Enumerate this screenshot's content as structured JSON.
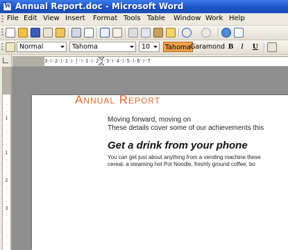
{
  "window": {
    "title": "Annual Report.doc - Microsoft Word"
  },
  "menu": {
    "items": [
      {
        "label": "File"
      },
      {
        "label": "Edit"
      },
      {
        "label": "View"
      },
      {
        "label": "Insert"
      },
      {
        "label": "Format"
      },
      {
        "label": "Tools"
      },
      {
        "label": "Table"
      },
      {
        "label": "Window"
      },
      {
        "label": "Work"
      },
      {
        "label": "Help"
      }
    ]
  },
  "toolbar": {
    "icons": [
      "new-document",
      "open",
      "save",
      "permission",
      "email",
      "print",
      "print-preview",
      "spelling",
      "research",
      "cut",
      "copy",
      "paste",
      "format-painter",
      "undo",
      "redo",
      "hyperlink",
      "tables-borders"
    ]
  },
  "formatting": {
    "style": "Normal",
    "font": "Tahoma",
    "size": "10",
    "font_preview_1": "Tahoma",
    "font_preview_2": "Garamond",
    "bold": "B",
    "italic": "I",
    "underline": "U"
  },
  "colors": {
    "title_bar": "#1c55c8",
    "heading_accent": "#e8672a",
    "font_highlight": "#f2a24a"
  },
  "document": {
    "title": "Annual Report",
    "subtitle": "Moving forward, moving on",
    "summary": "These details cover some of our achievements this",
    "heading": "Get a drink from your phone",
    "paragraph_line1": "You can get just about anything from a vending machine these",
    "paragraph_line2": "cereal, a steaming hot Pot Noodle, freshly ground coffee, bo"
  }
}
